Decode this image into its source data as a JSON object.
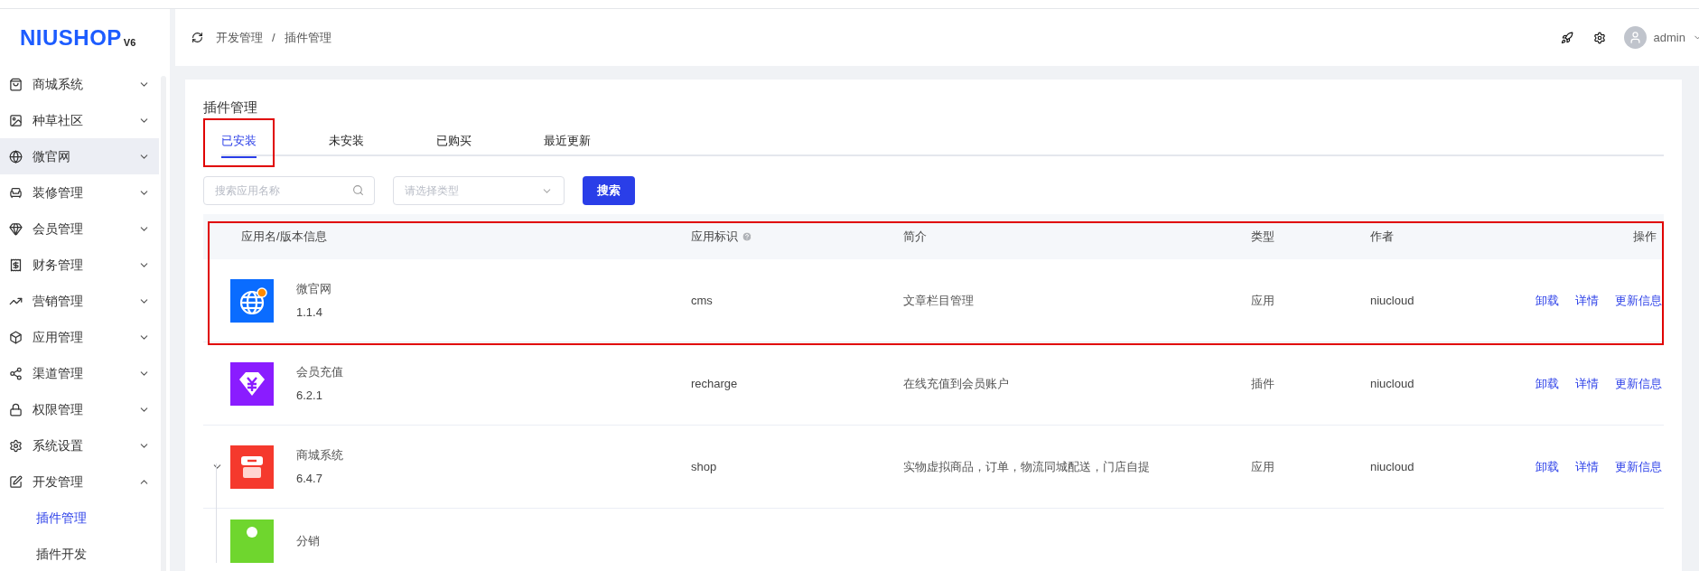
{
  "logo": {
    "brand": "NIUSHOP",
    "version": "V6"
  },
  "sidebar": {
    "items": [
      {
        "label": "商城系统",
        "highlighted": false,
        "expanded": false
      },
      {
        "label": "种草社区",
        "highlighted": false,
        "expanded": false
      },
      {
        "label": "微官网",
        "highlighted": true,
        "expanded": false
      },
      {
        "label": "装修管理",
        "highlighted": false,
        "expanded": false
      },
      {
        "label": "会员管理",
        "highlighted": false,
        "expanded": false
      },
      {
        "label": "财务管理",
        "highlighted": false,
        "expanded": false
      },
      {
        "label": "营销管理",
        "highlighted": false,
        "expanded": false
      },
      {
        "label": "应用管理",
        "highlighted": false,
        "expanded": false
      },
      {
        "label": "渠道管理",
        "highlighted": false,
        "expanded": false
      },
      {
        "label": "权限管理",
        "highlighted": false,
        "expanded": false
      },
      {
        "label": "系统设置",
        "highlighted": false,
        "expanded": false
      },
      {
        "label": "开发管理",
        "highlighted": false,
        "expanded": true,
        "children": [
          {
            "label": "插件管理",
            "selected": true
          },
          {
            "label": "插件开发",
            "selected": false
          }
        ]
      }
    ]
  },
  "breadcrumb": [
    "开发管理",
    "/",
    "插件管理"
  ],
  "user": {
    "name": "admin"
  },
  "page_title": "插件管理",
  "tabs": [
    {
      "label": "已安装",
      "selected": true,
      "annotated": true
    },
    {
      "label": "未安装",
      "selected": false,
      "annotated": false
    },
    {
      "label": "已购买",
      "selected": false,
      "annotated": false
    },
    {
      "label": "最近更新",
      "selected": false,
      "annotated": false
    }
  ],
  "search": {
    "placeholder": "搜索应用名称"
  },
  "type_select": {
    "placeholder": "请选择类型"
  },
  "search_button": "搜索",
  "table": {
    "columns": [
      "应用名/版本信息",
      "应用标识",
      "简介",
      "类型",
      "作者",
      "操作"
    ],
    "rows": [
      {
        "kind": "globe",
        "color": "#0a6cff",
        "name": "微官网",
        "version": "1.1.4",
        "key": "cms",
        "description": "文章栏目管理",
        "type": "应用",
        "author": "niucloud",
        "actions": [
          "卸载",
          "详情",
          "更新信息"
        ],
        "annotated": true
      },
      {
        "kind": "yen",
        "color": "#8a1cff",
        "name": "会员充值",
        "version": "6.2.1",
        "key": "recharge",
        "description": "在线充值到会员账户",
        "type": "插件",
        "author": "niucloud",
        "actions": [
          "卸载",
          "详情",
          "更新信息"
        ],
        "annotated": false
      },
      {
        "kind": "store",
        "color": "#f5392d",
        "name": "商城系统",
        "version": "6.4.7",
        "key": "shop",
        "description": "实物虚拟商品，订单，物流同城配送，门店自提",
        "type": "应用",
        "author": "niucloud",
        "actions": [
          "卸载",
          "详情",
          "更新信息"
        ],
        "annotated": false,
        "expanded": true,
        "children": [
          {
            "kind": "tag",
            "color": "#6fd62e",
            "name": "分销"
          }
        ]
      }
    ]
  }
}
